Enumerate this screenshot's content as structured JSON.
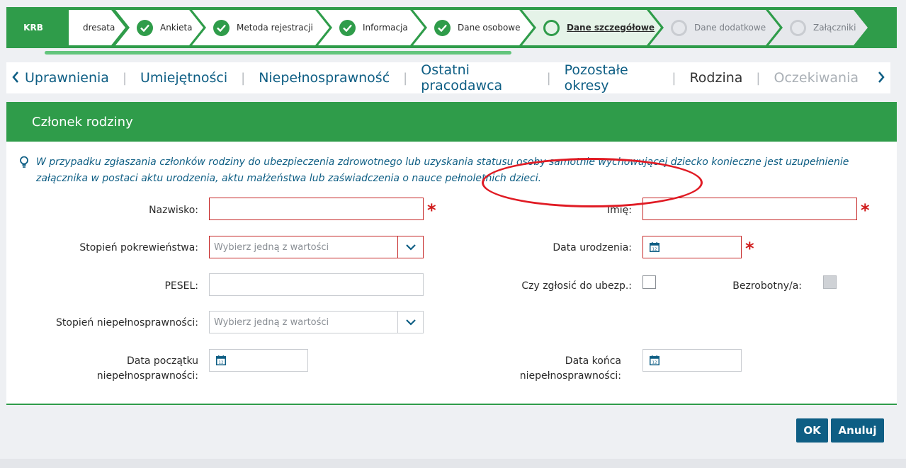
{
  "stepbar": {
    "brand": "KRB",
    "steps": [
      {
        "label": "dresata",
        "state": "done"
      },
      {
        "label": "Ankieta",
        "state": "done"
      },
      {
        "label": "Metoda rejestracji",
        "state": "done"
      },
      {
        "label": "Informacja",
        "state": "done"
      },
      {
        "label": "Dane osobowe",
        "state": "done"
      },
      {
        "label": "Dane szczegółowe",
        "state": "current"
      },
      {
        "label": "Dane dodatkowe",
        "state": "future"
      },
      {
        "label": "Załączniki",
        "state": "future"
      }
    ]
  },
  "tabs": {
    "prev_icon": "chevron-left-icon",
    "next_icon": "chevron-right-icon",
    "items": [
      "Uprawnienia",
      "Umiejętności",
      "Niepełnosprawność",
      "Ostatni pracodawca",
      "Pozostałe okresy",
      "Rodzina",
      "Oczekiwania"
    ],
    "active": "Rodzina",
    "disabled": "Oczekiwania"
  },
  "panel": {
    "title": "Członek rodziny",
    "info": "W przypadku zgłaszania członków rodziny do ubezpieczenia zdrowotnego lub uzyskania statusu osoby samotnie wychowującej dziecko konieczne jest uzupełnienie załącznika w postaci aktu urodzenia, aktu małżeństwa lub zaświadczenia o nauce pełnoletnich dzieci."
  },
  "form": {
    "nazwisko_label": "Nazwisko:",
    "imie_label": "Imię:",
    "stopien_pokrewienstwa_label": "Stopień pokrewieństwa:",
    "stopien_pokrewienstwa_placeholder": "Wybierz jedną z wartości",
    "data_urodzenia_label": "Data urodzenia:",
    "pesel_label": "PESEL:",
    "czy_zglosic_label": "Czy zgłosić do ubezp.:",
    "bezrobotny_label": "Bezrobotny/a:",
    "stopien_niepelnosprawnosci_label": "Stopień niepełnosprawności:",
    "stopien_niepelnosprawnosci_placeholder": "Wybierz jedną z wartości",
    "data_poczatku_label_1": "Data początku",
    "data_poczatku_label_2": "niepełnosprawności:",
    "data_konca_label_1": "Data końca",
    "data_konca_label_2": "niepełnosprawności:",
    "required_mark": "*"
  },
  "buttons": {
    "ok": "OK",
    "cancel": "Anuluj"
  },
  "colors": {
    "brand_green": "#2f9c4a",
    "link_blue": "#0e5e84",
    "error_red": "#c62828"
  }
}
